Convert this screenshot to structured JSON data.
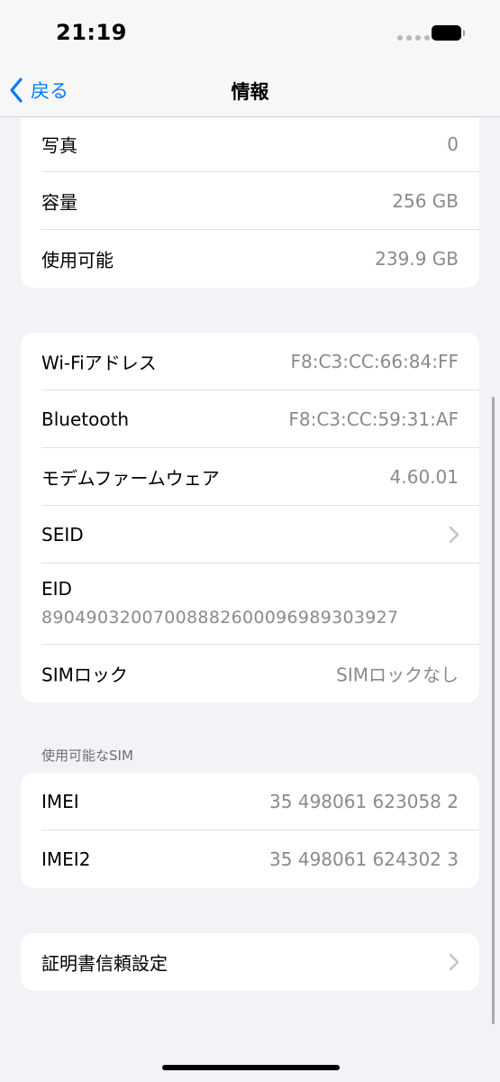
{
  "status_bar": {
    "time": "21:19"
  },
  "nav": {
    "back_label": "戻る",
    "title": "情報"
  },
  "group1": [
    {
      "label": "写真",
      "value": "0"
    },
    {
      "label": "容量",
      "value": "256 GB"
    },
    {
      "label": "使用可能",
      "value": "239.9 GB"
    }
  ],
  "group2": {
    "wifi": {
      "label": "Wi-Fiアドレス",
      "value": "F8:C3:CC:66:84:FF"
    },
    "bluetooth": {
      "label": "Bluetooth",
      "value": "F8:C3:CC:59:31:AF"
    },
    "modem": {
      "label": "モデムファームウェア",
      "value": "4.60.01"
    },
    "seid": {
      "label": "SEID"
    },
    "eid": {
      "label": "EID",
      "value": "89049032007008882600096989303927"
    },
    "sim_lock": {
      "label": "SIMロック",
      "value": "SIMロックなし"
    }
  },
  "sim_section": {
    "header": "使用可能なSIM",
    "imei": {
      "label": "IMEI",
      "value": "35 498061 623058 2"
    },
    "imei2": {
      "label": "IMEI2",
      "value": "35 498061 624302 3"
    }
  },
  "certificate": {
    "label": "証明書信頼設定"
  }
}
